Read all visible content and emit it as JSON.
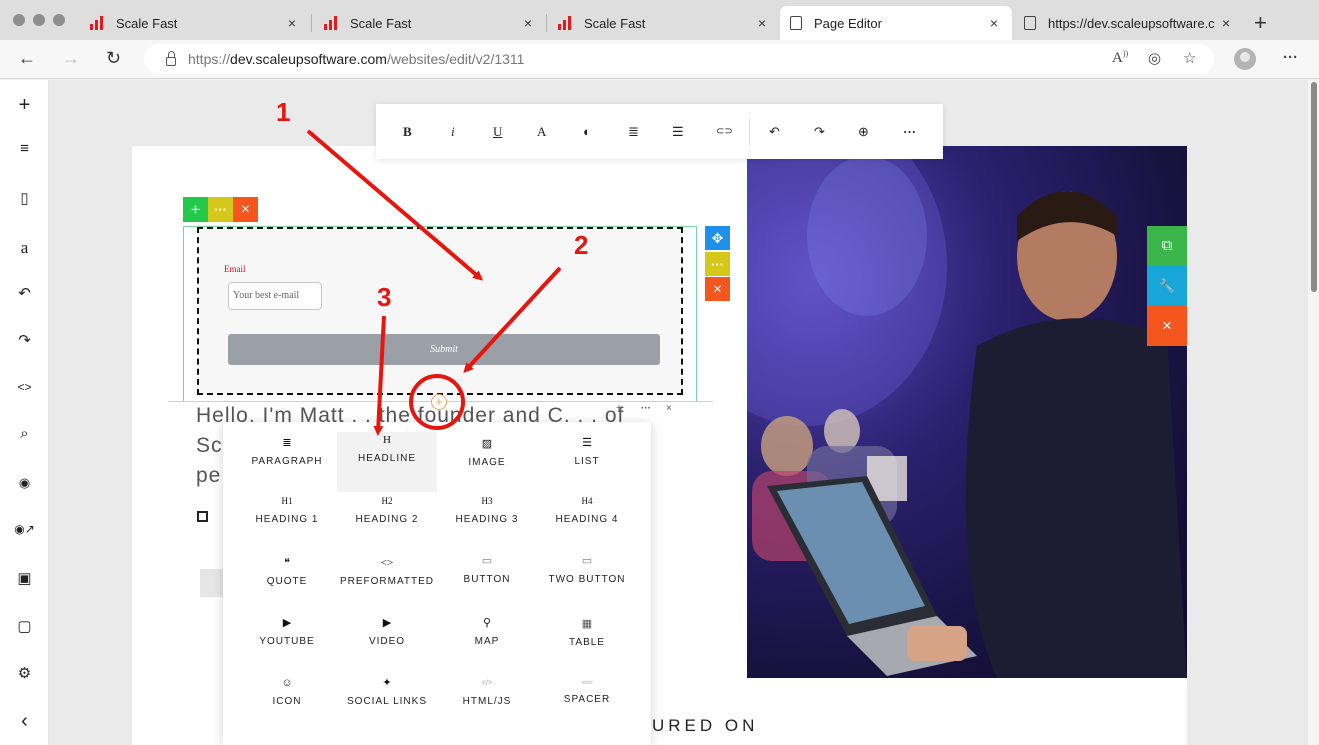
{
  "browser": {
    "tabs": [
      {
        "label": "Scale Fast",
        "icon": "scalefast-logo-icon"
      },
      {
        "label": "Scale Fast",
        "icon": "scalefast-logo-icon"
      },
      {
        "label": "Scale Fast",
        "icon": "scalefast-logo-icon"
      },
      {
        "label": "Page Editor",
        "icon": "page-icon"
      },
      {
        "label": "https://dev.scaleupsoftware.c",
        "icon": "page-icon"
      }
    ],
    "close_glyph": "×",
    "new_tab_glyph": "+",
    "url_prefix": "https://",
    "url_host": "dev.scaleupsoftware.com",
    "url_path": "/websites/edit/v2/1311",
    "nav": {
      "back": "←",
      "forward": "→",
      "reload": "↻"
    },
    "menu_glyph": "···"
  },
  "sidebar": {
    "items": [
      {
        "name": "add-icon",
        "glyph": "+"
      },
      {
        "name": "sections-icon",
        "glyph": "≡"
      },
      {
        "name": "pages-icon",
        "glyph": "▯"
      },
      {
        "name": "typography-icon",
        "glyph": "a"
      },
      {
        "name": "undo-icon",
        "glyph": "↶"
      },
      {
        "name": "redo-icon",
        "glyph": "↷"
      },
      {
        "name": "code-icon",
        "glyph": "<>"
      },
      {
        "name": "zoom-icon",
        "glyph": "⌕"
      },
      {
        "name": "preview-icon",
        "glyph": "◉"
      },
      {
        "name": "preview-external-icon",
        "glyph": "◉↗"
      },
      {
        "name": "save-icon",
        "glyph": "▣"
      },
      {
        "name": "clipboard-icon",
        "glyph": "▢"
      },
      {
        "name": "settings-icon",
        "glyph": "⚙"
      },
      {
        "name": "collapse-icon",
        "glyph": "‹"
      }
    ]
  },
  "text_toolbar": {
    "buttons": [
      {
        "name": "bold-button",
        "glyph": "B"
      },
      {
        "name": "italic-button",
        "glyph": "i"
      },
      {
        "name": "underline-button",
        "glyph": "U"
      },
      {
        "name": "font-button",
        "glyph": "A"
      },
      {
        "name": "color-button",
        "glyph": "◐"
      },
      {
        "name": "align-button",
        "glyph": "≣"
      },
      {
        "name": "spacing-button",
        "glyph": "☰"
      },
      {
        "name": "link-button",
        "glyph": "⊂⊃"
      },
      {
        "name": "undo-button",
        "glyph": "↶"
      },
      {
        "name": "redo-button",
        "glyph": "↷"
      },
      {
        "name": "zoom-button",
        "glyph": "⊕"
      },
      {
        "name": "more-button",
        "glyph": "···"
      }
    ]
  },
  "element_controls": {
    "add": "+",
    "more": "···",
    "delete": "×",
    "move": "✥"
  },
  "form": {
    "email_label": "Email",
    "email_placeholder": "Your best e-mail",
    "submit_label": "Submit"
  },
  "insert_plus": "+",
  "mini_controls": {
    "add": "+",
    "more": "···",
    "close": "×"
  },
  "background_text": {
    "line1": "Hello, I'm Matt . . the founder and C. . . of",
    "line2": "Sc",
    "line3": "pe",
    "featured": "URED ON"
  },
  "side_actions": {
    "duplicate": "⧉",
    "settings": "🔧",
    "delete": "×"
  },
  "insert_menu": {
    "items": [
      {
        "label": "PARAGRAPH",
        "glyph": "≣",
        "name": "paragraph"
      },
      {
        "label": "HEADLINE",
        "glyph": "H",
        "name": "headline"
      },
      {
        "label": "IMAGE",
        "glyph": "▨",
        "name": "image"
      },
      {
        "label": "LIST",
        "glyph": "☰",
        "name": "list"
      },
      {
        "label": "HEADING 1",
        "glyph": "H1",
        "name": "heading-1"
      },
      {
        "label": "HEADING 2",
        "glyph": "H2",
        "name": "heading-2"
      },
      {
        "label": "HEADING 3",
        "glyph": "H3",
        "name": "heading-3"
      },
      {
        "label": "HEADING 4",
        "glyph": "H4",
        "name": "heading-4"
      },
      {
        "label": "QUOTE",
        "glyph": "❝",
        "name": "quote"
      },
      {
        "label": "PREFORMATTED",
        "glyph": "<>",
        "name": "preformatted"
      },
      {
        "label": "BUTTON",
        "glyph": "▭",
        "name": "button"
      },
      {
        "label": "TWO BUTTON",
        "glyph": "▭",
        "name": "two-button"
      },
      {
        "label": "YOUTUBE",
        "glyph": "▶",
        "name": "youtube"
      },
      {
        "label": "VIDEO",
        "glyph": "▶",
        "name": "video"
      },
      {
        "label": "MAP",
        "glyph": "⚲",
        "name": "map"
      },
      {
        "label": "TABLE",
        "glyph": "▦",
        "name": "table"
      },
      {
        "label": "ICON",
        "glyph": "☺",
        "name": "icon"
      },
      {
        "label": "SOCIAL LINKS",
        "glyph": "✦",
        "name": "social-links"
      },
      {
        "label": "HTML/JS",
        "glyph": "</>",
        "name": "html-js"
      },
      {
        "label": "SPACER",
        "glyph": "▬",
        "name": "spacer"
      }
    ]
  },
  "annotations": {
    "n1": "1",
    "n2": "2",
    "n3": "3"
  },
  "colors": {
    "green": "#24c84a",
    "yellow": "#d6c81a",
    "orange": "#f4561e",
    "blue": "#1e90e8",
    "sideGreen": "#39b54a",
    "sideBlue": "#18a6d8",
    "arrow": "#e8150e"
  }
}
